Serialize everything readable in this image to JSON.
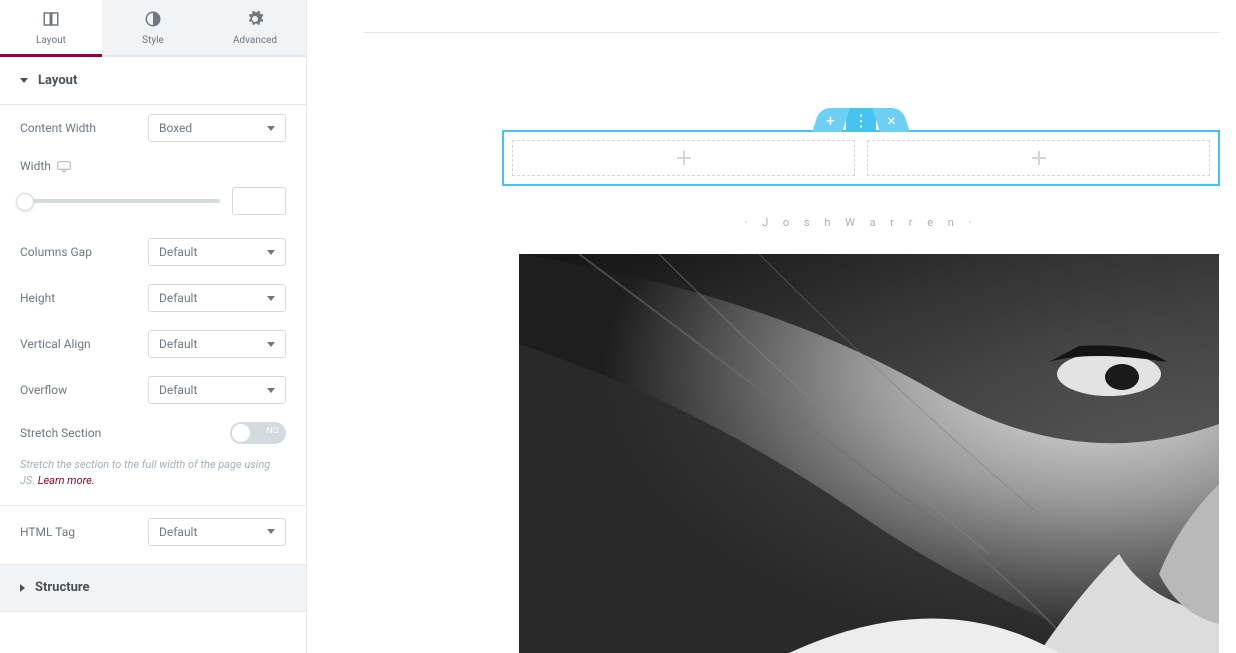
{
  "tabs": {
    "layout": "Layout",
    "style": "Style",
    "advanced": "Advanced"
  },
  "sections": {
    "layout": "Layout",
    "structure": "Structure"
  },
  "controls": {
    "content_width": {
      "label": "Content Width",
      "value": "Boxed"
    },
    "width": {
      "label": "Width",
      "value": ""
    },
    "columns_gap": {
      "label": "Columns Gap",
      "value": "Default"
    },
    "height": {
      "label": "Height",
      "value": "Default"
    },
    "vertical_align": {
      "label": "Vertical Align",
      "value": "Default"
    },
    "overflow": {
      "label": "Overflow",
      "value": "Default"
    },
    "stretch": {
      "label": "Stretch Section",
      "toggle_text": "NO"
    },
    "stretch_help": "Stretch the section to the full width of the page using JS. ",
    "stretch_help_link": "Learn more.",
    "html_tag": {
      "label": "HTML Tag",
      "value": "Default"
    }
  },
  "preview": {
    "author_label": "· J o s h   W a r r e n ·"
  }
}
